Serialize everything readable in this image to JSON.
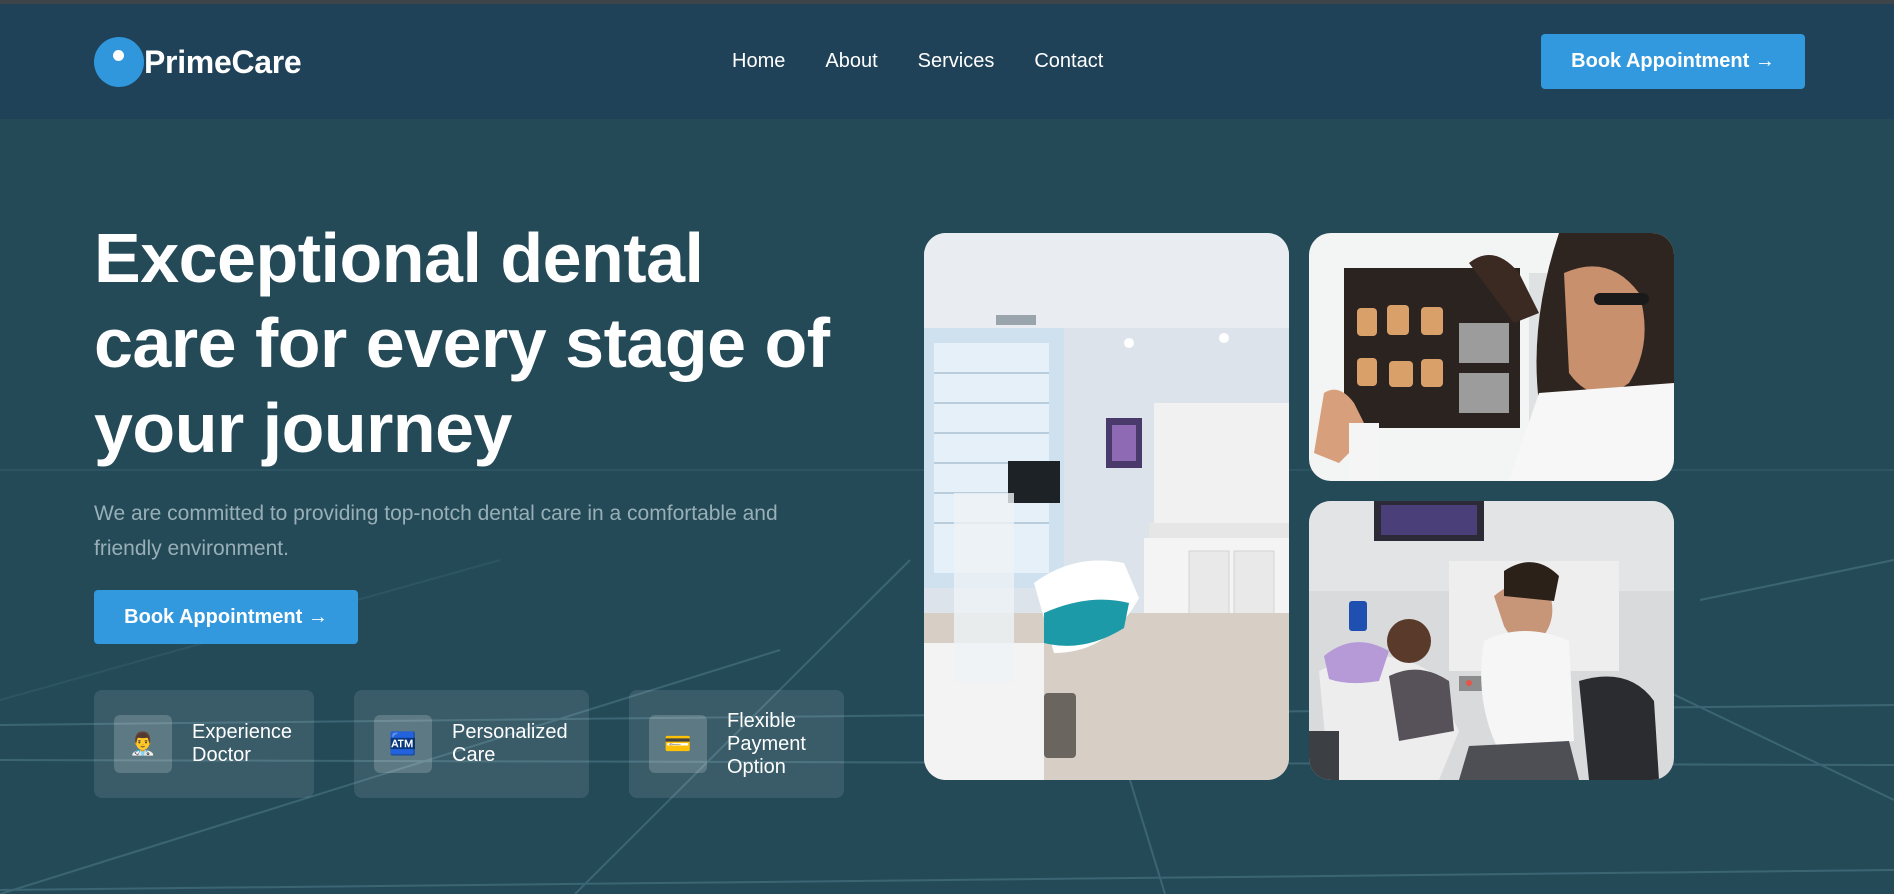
{
  "brand": {
    "name": "PrimeCare"
  },
  "nav": {
    "links": [
      "Home",
      "About",
      "Services",
      "Contact"
    ],
    "cta_label": "Book Appointment →"
  },
  "hero": {
    "title_lines": [
      "Exceptional dental",
      "care for every stage of",
      "your journey"
    ],
    "subtitle_lines": [
      "We are committed to providing top-notch dental care in a comfortable and",
      "friendly environment."
    ],
    "cta_label": "Book Appointment →"
  },
  "features": [
    {
      "icon": "doctor-icon",
      "glyph": "👨‍⚕️",
      "lines": [
        "Experience",
        "Doctor"
      ]
    },
    {
      "icon": "personalized-care-icon",
      "glyph": "🏧",
      "lines": [
        "Personalized",
        "Care"
      ]
    },
    {
      "icon": "credit-card-icon",
      "glyph": "💳",
      "lines": [
        "Flexible",
        "Payment",
        "Option"
      ]
    }
  ],
  "images": [
    {
      "name": "dental-clinic-room-photo"
    },
    {
      "name": "dentist-xray-photo"
    },
    {
      "name": "dentist-patient-photo"
    }
  ],
  "colors": {
    "background": "#244a58",
    "navbar": "#1f4258",
    "accent": "#3399de",
    "subtitle": "#98afb7"
  }
}
